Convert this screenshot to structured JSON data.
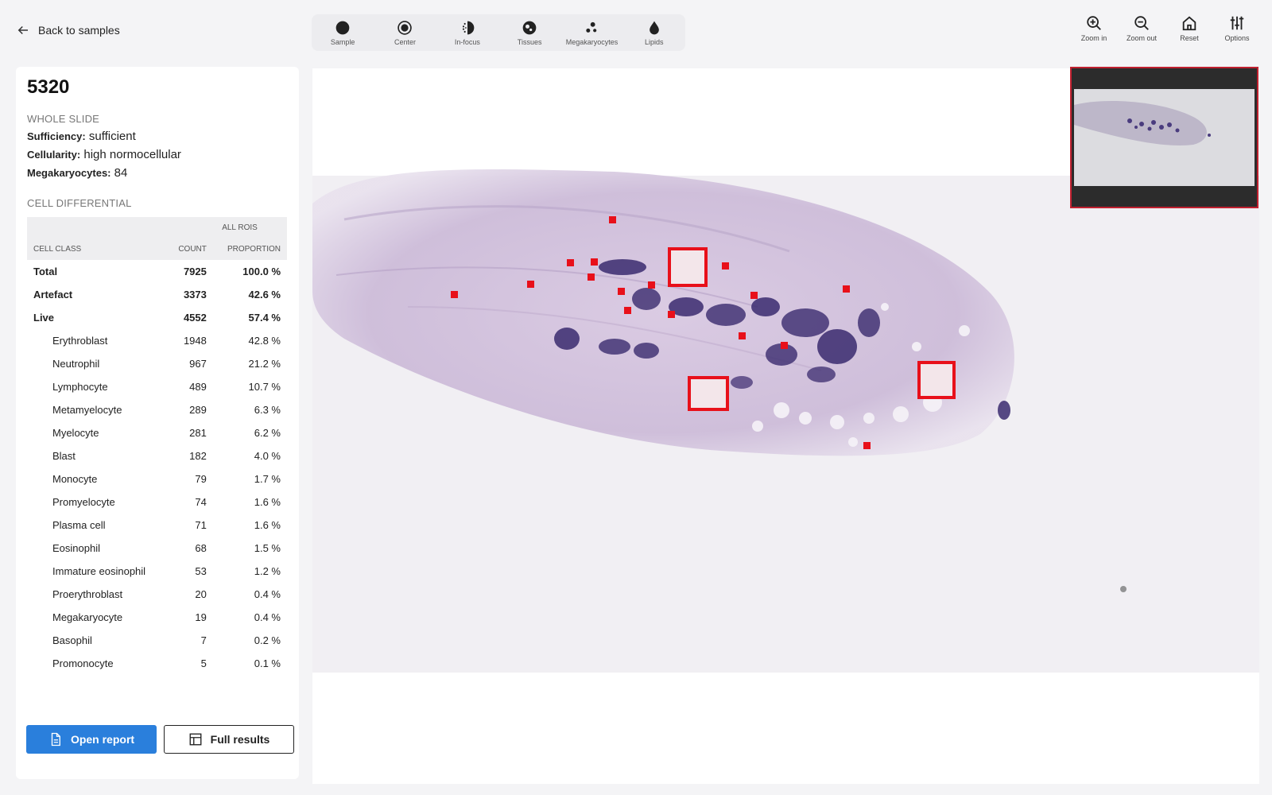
{
  "nav": {
    "back_label": "Back to samples"
  },
  "toolbar": [
    {
      "label": "Sample",
      "icon": "circle-filled-icon"
    },
    {
      "label": "Center",
      "icon": "target-icon"
    },
    {
      "label": "In-focus",
      "icon": "focus-icon"
    },
    {
      "label": "Tissues",
      "icon": "tissues-icon"
    },
    {
      "label": "Megakaryocytes",
      "icon": "cells-icon"
    },
    {
      "label": "Lipids",
      "icon": "droplet-icon"
    }
  ],
  "right_tools": [
    {
      "label": "Zoom in",
      "icon": "zoom-in-icon"
    },
    {
      "label": "Zoom out",
      "icon": "zoom-out-icon"
    },
    {
      "label": "Reset",
      "icon": "home-icon"
    },
    {
      "label": "Options",
      "icon": "sliders-icon"
    }
  ],
  "sample": {
    "id": "5320",
    "whole_slide_heading": "WHOLE SLIDE",
    "sufficiency_label": "Sufficiency:",
    "sufficiency_value": "sufficient",
    "cellularity_label": "Cellularity:",
    "cellularity_value": "high normocellular",
    "megakaryocytes_label": "Megakaryocytes:",
    "megakaryocytes_value": "84",
    "differential_heading": "CELL DIFFERENTIAL"
  },
  "table": {
    "group_header": "ALL ROIS",
    "col_class": "CELL CLASS",
    "col_count": "COUNT",
    "col_proportion": "PROPORTION",
    "rows": [
      {
        "name": "Total",
        "count": "7925",
        "proportion": "100.0 %",
        "bold": true,
        "indent": false
      },
      {
        "name": "Artefact",
        "count": "3373",
        "proportion": "42.6 %",
        "bold": true,
        "indent": false
      },
      {
        "name": "Live",
        "count": "4552",
        "proportion": "57.4 %",
        "bold": true,
        "indent": false
      },
      {
        "name": "Erythroblast",
        "count": "1948",
        "proportion": "42.8 %",
        "bold": false,
        "indent": true
      },
      {
        "name": "Neutrophil",
        "count": "967",
        "proportion": "21.2 %",
        "bold": false,
        "indent": true
      },
      {
        "name": "Lymphocyte",
        "count": "489",
        "proportion": "10.7 %",
        "bold": false,
        "indent": true
      },
      {
        "name": "Metamyelocyte",
        "count": "289",
        "proportion": "6.3 %",
        "bold": false,
        "indent": true
      },
      {
        "name": "Myelocyte",
        "count": "281",
        "proportion": "6.2 %",
        "bold": false,
        "indent": true
      },
      {
        "name": "Blast",
        "count": "182",
        "proportion": "4.0 %",
        "bold": false,
        "indent": true
      },
      {
        "name": "Monocyte",
        "count": "79",
        "proportion": "1.7 %",
        "bold": false,
        "indent": true
      },
      {
        "name": "Promyelocyte",
        "count": "74",
        "proportion": "1.6 %",
        "bold": false,
        "indent": true
      },
      {
        "name": "Plasma cell",
        "count": "71",
        "proportion": "1.6 %",
        "bold": false,
        "indent": true
      },
      {
        "name": "Eosinophil",
        "count": "68",
        "proportion": "1.5 %",
        "bold": false,
        "indent": true
      },
      {
        "name": "Immature eosinophil",
        "count": "53",
        "proportion": "1.2 %",
        "bold": false,
        "indent": true
      },
      {
        "name": "Proerythroblast",
        "count": "20",
        "proportion": "0.4 %",
        "bold": false,
        "indent": true
      },
      {
        "name": "Megakaryocyte",
        "count": "19",
        "proportion": "0.4 %",
        "bold": false,
        "indent": true
      },
      {
        "name": "Basophil",
        "count": "7",
        "proportion": "0.2 %",
        "bold": false,
        "indent": true
      },
      {
        "name": "Promonocyte",
        "count": "5",
        "proportion": "0.1 %",
        "bold": false,
        "indent": true
      }
    ]
  },
  "actions": {
    "open_report": "Open report",
    "full_results": "Full results"
  },
  "colors": {
    "primary": "#2a7fdc",
    "roi_marker": "#e8101a",
    "stain_dark": "#3a2a6e",
    "stain_light": "#c9b8d6"
  }
}
